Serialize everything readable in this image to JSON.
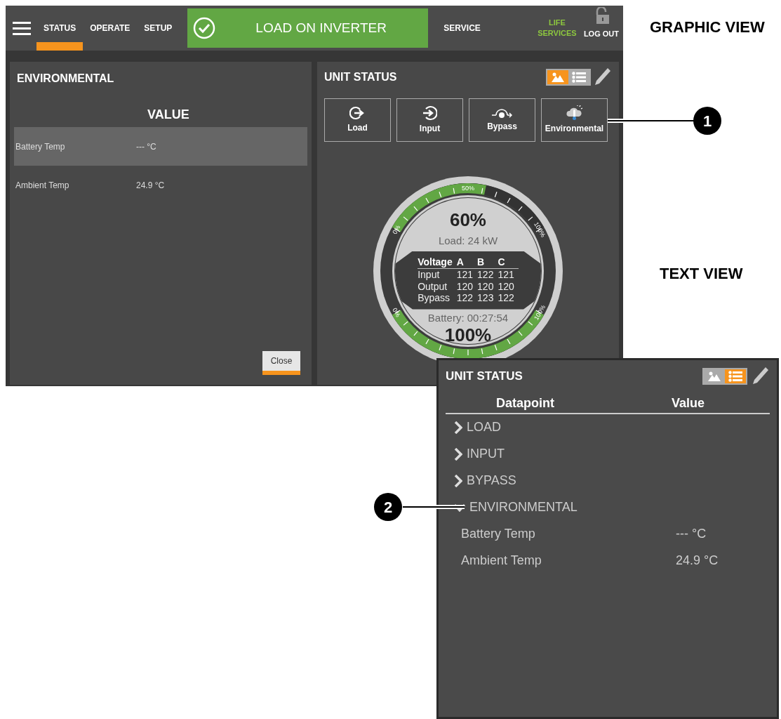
{
  "top_bar": {
    "tabs": [
      {
        "label": "STATUS",
        "selected": true
      },
      {
        "label": "OPERATE",
        "selected": false
      },
      {
        "label": "SETUP",
        "selected": false
      }
    ],
    "status_banner": "LOAD ON INVERTER",
    "service": "SERVICE",
    "life_services": "LIFE SERVICES",
    "logout": "LOG OUT"
  },
  "environmental_panel": {
    "title": "ENVIRONMENTAL",
    "column": "VALUE",
    "rows": [
      {
        "label": "Battery Temp",
        "value": "--- °C",
        "selected": true
      },
      {
        "label": "Ambient Temp",
        "value": "24.9 °C",
        "selected": false
      }
    ],
    "close": "Close"
  },
  "unit_status": {
    "title": "UNIT STATUS",
    "views": [
      {
        "kind": "graphic",
        "selected": true
      },
      {
        "kind": "list",
        "selected": false
      }
    ],
    "buttons": [
      {
        "label": "Load",
        "kind": "load"
      },
      {
        "label": "Input",
        "kind": "input"
      },
      {
        "label": "Bypass",
        "kind": "bypass"
      },
      {
        "label": "Environmental",
        "kind": "environmental"
      }
    ],
    "gauge": {
      "load": {
        "percent": "60%",
        "caption": "Load: 24 kW",
        "level": 0.6,
        "scale": [
          "0%",
          "50%",
          "100%"
        ]
      },
      "voltage_table": {
        "columns": [
          "Voltage",
          "A",
          "B",
          "C"
        ],
        "rows": [
          [
            "Input",
            "121",
            "122",
            "121"
          ],
          [
            "Output",
            "120",
            "120",
            "120"
          ],
          [
            "Bypass",
            "122",
            "123",
            "122"
          ]
        ]
      },
      "battery": {
        "caption": "Battery: 00:27:54",
        "percent": "100%",
        "level": 1,
        "scale": [
          "0%",
          "100%"
        ]
      }
    }
  },
  "text_view": {
    "title": "UNIT STATUS",
    "views": [
      {
        "kind": "graphic",
        "selected": false
      },
      {
        "kind": "list",
        "selected": true
      }
    ],
    "columns": [
      "Datapoint",
      "Value"
    ],
    "rows": [
      {
        "label": "LOAD",
        "expanded": false
      },
      {
        "label": "INPUT",
        "expanded": false
      },
      {
        "label": "BYPASS",
        "expanded": false
      },
      {
        "label": "ENVIRONMENTAL",
        "expanded": true,
        "children": [
          {
            "label": "Battery Temp",
            "value": "--- °C"
          },
          {
            "label": "Ambient Temp",
            "value": "24.9 °C"
          }
        ]
      }
    ]
  },
  "callouts": [
    {
      "label": "GRAPHIC VIEW"
    },
    {
      "label": "TEXT VIEW"
    }
  ],
  "markers": [
    "1",
    "2"
  ]
}
